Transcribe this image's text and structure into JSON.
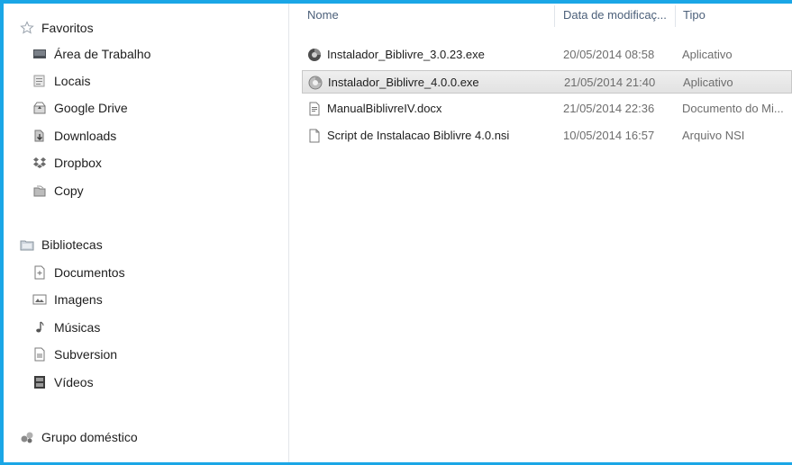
{
  "nav": {
    "favorites": {
      "label": "Favoritos",
      "items": [
        {
          "label": "Área de Trabalho",
          "icon": "desktop-icon"
        },
        {
          "label": "Locais",
          "icon": "recent-places-icon"
        },
        {
          "label": "Google Drive",
          "icon": "google-drive-icon"
        },
        {
          "label": "Downloads",
          "icon": "downloads-icon"
        },
        {
          "label": "Dropbox",
          "icon": "dropbox-icon"
        },
        {
          "label": "Copy",
          "icon": "copy-folder-icon"
        }
      ]
    },
    "libraries": {
      "label": "Bibliotecas",
      "items": [
        {
          "label": "Documentos",
          "icon": "documents-icon"
        },
        {
          "label": "Imagens",
          "icon": "pictures-icon"
        },
        {
          "label": "Músicas",
          "icon": "music-icon"
        },
        {
          "label": "Subversion",
          "icon": "subversion-icon"
        },
        {
          "label": "Vídeos",
          "icon": "videos-icon"
        }
      ]
    },
    "homegroup": {
      "label": "Grupo doméstico"
    }
  },
  "columns": {
    "name": "Nome",
    "date": "Data de modificaç...",
    "type": "Tipo"
  },
  "files": [
    {
      "name": "Instalador_Biblivre_3.0.23.exe",
      "date": "20/05/2014 08:58",
      "type": "Aplicativo",
      "icon": "installer-icon",
      "selected": false
    },
    {
      "name": "Instalador_Biblivre_4.0.0.exe",
      "date": "21/05/2014 21:40",
      "type": "Aplicativo",
      "icon": "installer-icon",
      "selected": true
    },
    {
      "name": "ManualBiblivreIV.docx",
      "date": "21/05/2014 22:36",
      "type": "Documento do Mi...",
      "icon": "word-document-icon",
      "selected": false
    },
    {
      "name": "Script de Instalacao Biblivre 4.0.nsi",
      "date": "10/05/2014 16:57",
      "type": "Arquivo NSI",
      "icon": "file-icon",
      "selected": false
    }
  ],
  "colors": {
    "accent_border": "#1aa6e6",
    "header_text": "#4c607a",
    "selection_bg": "#e6e6e6"
  }
}
